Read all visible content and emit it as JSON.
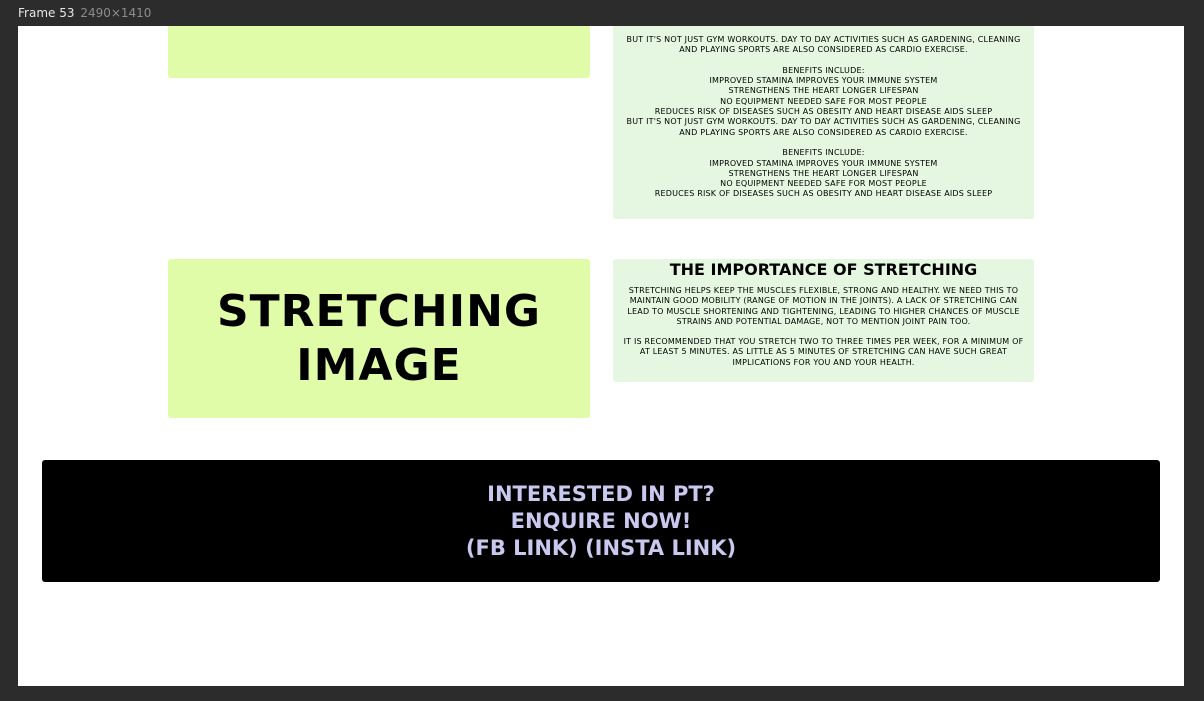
{
  "frame": {
    "name": "Frame 53",
    "dimensions": "2490×1410"
  },
  "cardio": {
    "paragraph": "BUT IT'S NOT JUST GYM WORKOUTS. DAY TO DAY ACTIVITIES SUCH AS GARDENING, CLEANING AND PLAYING SPORTS ARE ALSO CONSIDERED AS CARDIO EXERCISE.\n\nBENEFITS INCLUDE:\nIMPROVED STAMINA  IMPROVES YOUR IMMUNE SYSTEM\nSTRENGTHENS THE HEART  LONGER LIFESPAN\nNO EQUIPMENT NEEDED  SAFE FOR MOST PEOPLE\nREDUCES RISK OF DISEASES SUCH AS OBESITY AND HEART DISEASE AIDS SLEEP\nBUT IT'S NOT JUST GYM WORKOUTS. DAY TO DAY ACTIVITIES SUCH AS GARDENING, CLEANING AND PLAYING SPORTS ARE ALSO CONSIDERED AS CARDIO EXERCISE.\n\nBENEFITS INCLUDE:\nIMPROVED STAMINA  IMPROVES YOUR IMMUNE SYSTEM\nSTRENGTHENS THE HEART  LONGER LIFESPAN\nNO EQUIPMENT NEEDED  SAFE FOR MOST PEOPLE\nREDUCES RISK OF DISEASES SUCH AS OBESITY AND HEART DISEASE AIDS SLEEP"
  },
  "stretching": {
    "image_label_line1": "STRETCHING",
    "image_label_line2": "IMAGE",
    "title": "THE IMPORTANCE OF STRETCHING",
    "paragraph1": "STRETCHING HELPS KEEP THE MUSCLES FLEXIBLE, STRONG AND HEALTHY.  WE NEED THIS TO MAINTAIN GOOD MOBILITY (RANGE OF MOTION IN THE JOINTS). A LACK OF STRETCHING CAN LEAD TO MUSCLE SHORTENING AND TIGHTENING, LEADING TO HIGHER CHANCES OF MUSCLE STRAINS AND POTENTIAL DAMAGE, NOT TO MENTION JOINT PAIN TOO.",
    "paragraph2": "IT IS RECOMMENDED THAT YOU STRETCH TWO TO THREE TIMES PER WEEK, FOR A MINIMUM OF AT LEAST 5 MINUTES. AS LITTLE AS 5 MINUTES OF STRETCHING CAN HAVE SUCH GREAT IMPLICATIONS FOR YOU AND YOUR HEALTH."
  },
  "cta": {
    "line1": "INTERESTED IN PT?",
    "line2": "ENQUIRE NOW!",
    "line3": "(FB LINK) (INSTA LINK)"
  },
  "colors": {
    "editor_background": "#2c2c2c",
    "canvas": "#ffffff",
    "image_placeholder": "#e0fca8",
    "text_panel": "#e5f7e0",
    "cta_background": "#000000",
    "cta_text": "#c9c8ee"
  }
}
